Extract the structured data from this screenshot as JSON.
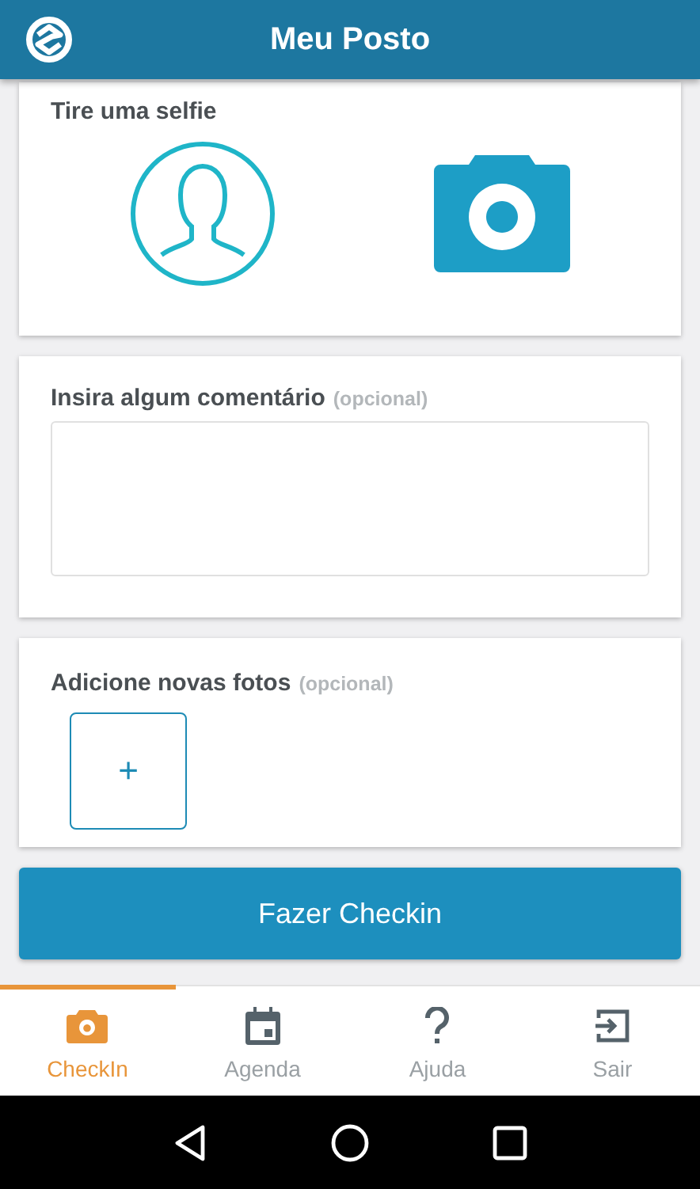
{
  "header": {
    "title": "Meu Posto"
  },
  "selfie_card": {
    "title": "Tire uma selfie"
  },
  "comment_card": {
    "title": "Insira algum comentário",
    "hint": "(opcional)"
  },
  "photos_card": {
    "title": "Adicione novas fotos",
    "hint": "(opcional)",
    "add_button": "+"
  },
  "checkin_button": "Fazer Checkin",
  "tabs": [
    {
      "label": "CheckIn",
      "kind": "camera",
      "selected": true
    },
    {
      "label": "Agenda",
      "kind": "calendar",
      "selected": false
    },
    {
      "label": "Ajuda",
      "kind": "help",
      "selected": false
    },
    {
      "label": "Sair",
      "kind": "exit",
      "selected": false
    }
  ]
}
